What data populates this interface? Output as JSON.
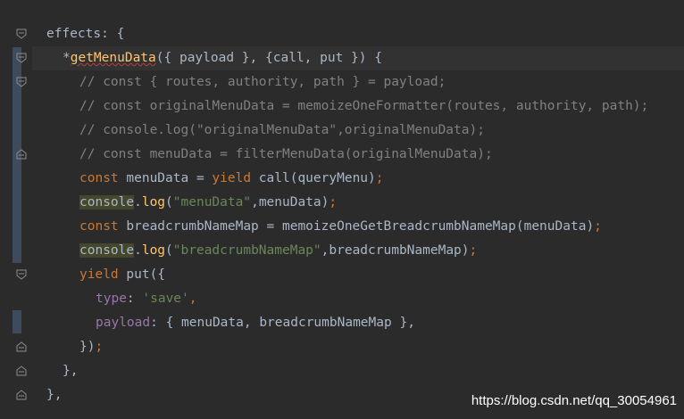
{
  "code": {
    "l1": "effects: {",
    "l2_star": "*",
    "l2_fn": "getMenuData",
    "l2_a": "({ ",
    "l2_payload": "payload",
    "l2_b": " }, {",
    "l2_call": "call",
    "l2_c": ", ",
    "l2_put": "put",
    "l2_d": " }) {",
    "l3": "// const { routes, authority, path } = payload;",
    "l4": "// const originalMenuData = memoizeOneFormatter(routes, authority, path);",
    "l5": "// console.log(\"originalMenuData\",originalMenuData);",
    "l6": "// const menuData = filterMenuData(originalMenuData);",
    "l7_kw": "const",
    "l7_a": " menuData = ",
    "l7_yield": "yield",
    "l7_b": " call(queryMenu)",
    "l7_semi": ";",
    "l8_console": "console",
    "l8_dot": ".",
    "l8_log": "log",
    "l8_a": "(",
    "l8_str": "\"menuData\"",
    "l8_b": ",menuData)",
    "l8_semi": ";",
    "l9_kw": "const",
    "l9_a": " breadcrumbNameMap = memoizeOneGetBreadcrumbNameMap(menuData)",
    "l9_semi": ";",
    "l10_console": "console",
    "l10_dot": ".",
    "l10_log": "log",
    "l10_a": "(",
    "l10_str": "\"breadcrumbNameMap\"",
    "l10_b": ",breadcrumbNameMap)",
    "l10_semi": ";",
    "l11_yield": "yield",
    "l11_a": " put({",
    "l12_type": "type",
    "l12_a": ": ",
    "l12_str": "'save'",
    "l12_b": ",",
    "l13_payload": "payload",
    "l13_a": ": { menuData, breadcrumbNameMap },",
    "l14_a": "})",
    "l14_semi": ";",
    "l15": "},",
    "l16": "},"
  },
  "watermark": "https://blog.csdn.net/qq_30054961",
  "colors": {
    "background": "#2b2b2b",
    "keyword": "#cc7832",
    "function": "#ffc66d",
    "string": "#6a8759",
    "property": "#9876aa",
    "comment": "#808080"
  }
}
